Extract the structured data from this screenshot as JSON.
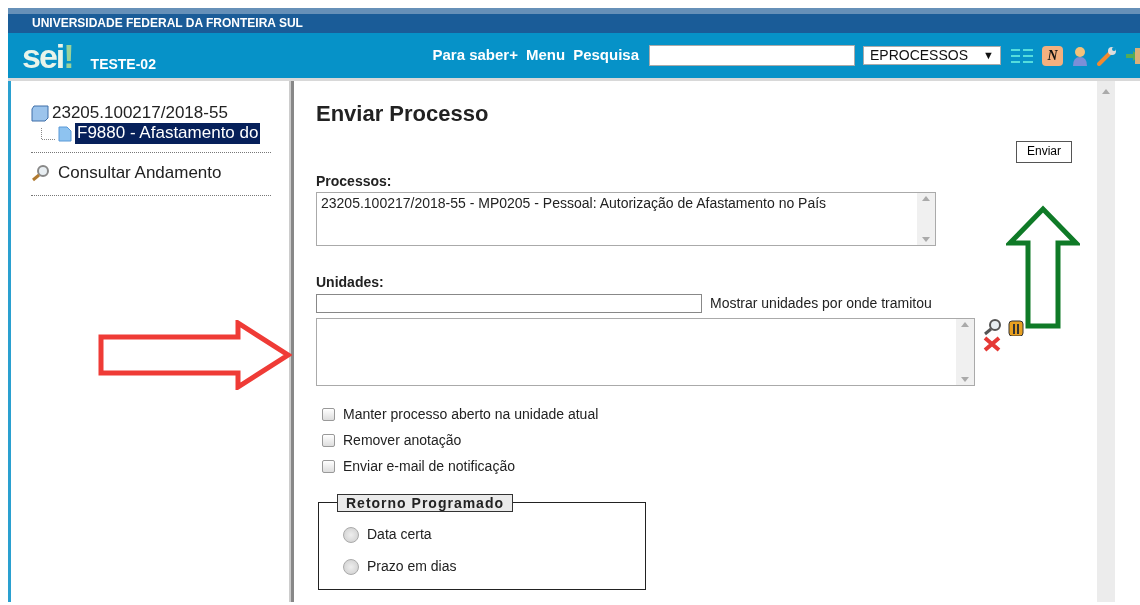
{
  "header": {
    "institution": "UNIVERSIDADE FEDERAL DA FRONTEIRA SUL",
    "logo": "sei",
    "logo_mark": "!",
    "unit": "TESTE-02",
    "links": [
      "Para saber+",
      "Menu",
      "Pesquisa"
    ],
    "scope_select": {
      "value": "EPROCESSOS",
      "caret": "▼"
    },
    "tool_icon_badge": "N"
  },
  "tree": {
    "process": "23205.100217/2018-55",
    "children": [
      {
        "label": "F9880 - Afastamento do",
        "selected": true
      }
    ]
  },
  "sidebar_links": [
    "Consultar Andamento"
  ],
  "form": {
    "title": "Enviar Processo",
    "send_button": "Enviar",
    "processes_label": "Processos:",
    "processes": [
      "23205.100217/2018-55 - MP0205 - Pessoal: Autorização de Afastamento no País"
    ],
    "units_label": "Unidades:",
    "units_link": "Mostrar unidades por onde tramitou",
    "options": [
      {
        "label": "Manter processo aberto na unidade atual",
        "checked": false
      },
      {
        "label": "Remover anotação",
        "checked": false
      },
      {
        "label": "Enviar e-mail de notificação",
        "checked": false
      }
    ],
    "return_legend": "Retorno Programado",
    "return_options": [
      {
        "label": "Data certa",
        "selected": false
      },
      {
        "label": "Prazo em dias",
        "selected": false
      }
    ]
  },
  "annotations": [
    {
      "kind": "right",
      "color": "#ef3b36"
    },
    {
      "kind": "up",
      "color": "#0f7a27"
    }
  ]
}
